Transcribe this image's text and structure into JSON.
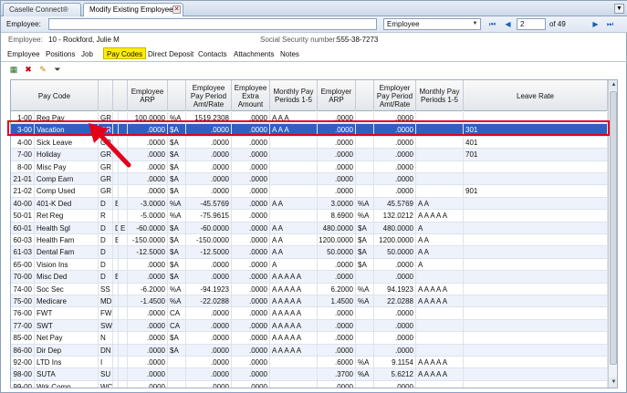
{
  "tabs": [
    {
      "label": "Caselle Connect®"
    },
    {
      "label": "Modify Existing Employees"
    }
  ],
  "employee_bar": {
    "label": "Employee:",
    "input_value": "",
    "select_value": "Employee",
    "page_value": "2",
    "page_total": "of 49"
  },
  "info": {
    "employee_label": "Employee:",
    "employee_value": "10 - Rockford, Julie M",
    "ssn_label": "Social Security number:",
    "ssn_value": "555-38-7273"
  },
  "subtabs": [
    "Employee",
    "Positions",
    "Job",
    "Pay Codes",
    "Direct Deposit",
    "Contacts",
    "Attachments",
    "Notes"
  ],
  "active_subtab": "Pay Codes",
  "toolbar_icons": [
    "grid-icon",
    "delete-icon",
    "pencil-icon",
    "filter-icon"
  ],
  "headers": {
    "pay_code": "Pay Code",
    "emp_arp": "Employee ARP",
    "emp_ppar": "Employee Pay Period Amt/Rate",
    "emp_extra": "Employee Extra Amount",
    "monthly1": "Monthly Pay Periods 1-5",
    "er_arp": "Employer ARP",
    "er_ppar": "Employer Pay Period Amt/Rate",
    "monthly2": "Monthly Pay Periods 1-5",
    "leave_rate": "Leave Rate"
  },
  "rows": [
    {
      "code": "1-00",
      "name": "Reg Pay",
      "type": "GR",
      "f1": "",
      "f2": "",
      "earp": "100.0000",
      "eu": "%A",
      "eppar": "1519.2308",
      "extra": ".0000",
      "m1": "A A A",
      "erarp": ".0000",
      "eru": "",
      "erppar": ".0000",
      "m2": "",
      "leave": ""
    },
    {
      "code": "3-00",
      "name": "Vacation",
      "type": "GR",
      "f1": "",
      "f2": "",
      "earp": ".0000",
      "eu": "$A",
      "eppar": ".0000",
      "extra": ".0000",
      "m1": "A A A",
      "erarp": ".0000",
      "eru": "",
      "erppar": ".0000",
      "m2": "",
      "leave": "301"
    },
    {
      "code": "4-00",
      "name": "Sick Leave",
      "type": "GR",
      "f1": "",
      "f2": "",
      "earp": ".0000",
      "eu": "$A",
      "eppar": ".0000",
      "extra": ".0000",
      "m1": "",
      "erarp": ".0000",
      "eru": "",
      "erppar": ".0000",
      "m2": "",
      "leave": "401"
    },
    {
      "code": "7-00",
      "name": "Holiday",
      "type": "GR",
      "f1": "",
      "f2": "",
      "earp": ".0000",
      "eu": "$A",
      "eppar": ".0000",
      "extra": ".0000",
      "m1": "",
      "erarp": ".0000",
      "eru": "",
      "erppar": ".0000",
      "m2": "",
      "leave": "701"
    },
    {
      "code": "8-00",
      "name": "Misc Pay",
      "type": "GR",
      "f1": "",
      "f2": "",
      "earp": ".0000",
      "eu": "$A",
      "eppar": ".0000",
      "extra": ".0000",
      "m1": "",
      "erarp": ".0000",
      "eru": "",
      "erppar": ".0000",
      "m2": "",
      "leave": ""
    },
    {
      "code": "21-01",
      "name": "Comp Earn",
      "type": "GR",
      "f1": "",
      "f2": "",
      "earp": ".0000",
      "eu": "$A",
      "eppar": ".0000",
      "extra": ".0000",
      "m1": "",
      "erarp": ".0000",
      "eru": "",
      "erppar": ".0000",
      "m2": "",
      "leave": ""
    },
    {
      "code": "21-02",
      "name": "Comp Used",
      "type": "GR",
      "f1": "",
      "f2": "",
      "earp": ".0000",
      "eu": "$A",
      "eppar": ".0000",
      "extra": ".0000",
      "m1": "",
      "erarp": ".0000",
      "eru": "",
      "erppar": ".0000",
      "m2": "",
      "leave": "901"
    },
    {
      "code": "40-00",
      "name": "401-K Ded",
      "type": "D",
      "f1": "B",
      "f2": "",
      "earp": "-3.0000",
      "eu": "%A",
      "eppar": "-45.5769",
      "extra": ".0000",
      "m1": "A A",
      "erarp": "3.0000",
      "eru": "%A",
      "erppar": "45.5769",
      "m2": "A A",
      "leave": ""
    },
    {
      "code": "50-01",
      "name": "Ret Reg",
      "type": "R",
      "f1": "",
      "f2": "",
      "earp": "-5.0000",
      "eu": "%A",
      "eppar": "-75.9615",
      "extra": ".0000",
      "m1": "",
      "erarp": "8.6900",
      "eru": "%A",
      "erppar": "132.0212",
      "m2": "A A A A A",
      "leave": ""
    },
    {
      "code": "60-01",
      "name": "Health Sgl",
      "type": "D",
      "f1": "D",
      "f2": "E",
      "earp": "-60.0000",
      "eu": "$A",
      "eppar": "-60.0000",
      "extra": ".0000",
      "m1": "A A",
      "erarp": "480.0000",
      "eru": "$A",
      "erppar": "480.0000",
      "m2": "A",
      "leave": ""
    },
    {
      "code": "60-03",
      "name": "Health Fam",
      "type": "D",
      "f1": "B",
      "f2": "",
      "earp": "-150.0000",
      "eu": "$A",
      "eppar": "-150.0000",
      "extra": ".0000",
      "m1": "A A",
      "erarp": "1200.0000",
      "eru": "$A",
      "erppar": "1200.0000",
      "m2": "A A",
      "leave": ""
    },
    {
      "code": "61-03",
      "name": "Dental Fam",
      "type": "D",
      "f1": "",
      "f2": "",
      "earp": "-12.5000",
      "eu": "$A",
      "eppar": "-12.5000",
      "extra": ".0000",
      "m1": "A A",
      "erarp": "50.0000",
      "eru": "$A",
      "erppar": "50.0000",
      "m2": "A A",
      "leave": ""
    },
    {
      "code": "65-00",
      "name": "Vision Ins",
      "type": "D",
      "f1": "",
      "f2": "",
      "earp": ".0000",
      "eu": "$A",
      "eppar": ".0000",
      "extra": ".0000",
      "m1": "A",
      "erarp": ".0000",
      "eru": "$A",
      "erppar": ".0000",
      "m2": "A",
      "leave": ""
    },
    {
      "code": "70-00",
      "name": "Misc Ded",
      "type": "D",
      "f1": "B",
      "f2": "",
      "earp": ".0000",
      "eu": "$A",
      "eppar": ".0000",
      "extra": ".0000",
      "m1": "A A A A A",
      "erarp": ".0000",
      "eru": "",
      "erppar": ".0000",
      "m2": "",
      "leave": ""
    },
    {
      "code": "74-00",
      "name": "Soc Sec",
      "type": "SS",
      "f1": "",
      "f2": "",
      "earp": "-6.2000",
      "eu": "%A",
      "eppar": "-94.1923",
      "extra": ".0000",
      "m1": "A A A A A",
      "erarp": "6.2000",
      "eru": "%A",
      "erppar": "94.1923",
      "m2": "A A A A A",
      "leave": ""
    },
    {
      "code": "75-00",
      "name": "Medicare",
      "type": "MD",
      "f1": "",
      "f2": "",
      "earp": "-1.4500",
      "eu": "%A",
      "eppar": "-22.0288",
      "extra": ".0000",
      "m1": "A A A A A",
      "erarp": "1.4500",
      "eru": "%A",
      "erppar": "22.0288",
      "m2": "A A A A A",
      "leave": ""
    },
    {
      "code": "76-00",
      "name": "FWT",
      "type": "FW",
      "f1": "",
      "f2": "",
      "earp": ".0000",
      "eu": "CA",
      "eppar": ".0000",
      "extra": ".0000",
      "m1": "A A A A A",
      "erarp": ".0000",
      "eru": "",
      "erppar": ".0000",
      "m2": "",
      "leave": ""
    },
    {
      "code": "77-00",
      "name": "SWT",
      "type": "SW",
      "f1": "",
      "f2": "",
      "earp": ".0000",
      "eu": "CA",
      "eppar": ".0000",
      "extra": ".0000",
      "m1": "A A A A A",
      "erarp": ".0000",
      "eru": "",
      "erppar": ".0000",
      "m2": "",
      "leave": ""
    },
    {
      "code": "85-00",
      "name": "Net Pay",
      "type": "N",
      "f1": "",
      "f2": "",
      "earp": ".0000",
      "eu": "$A",
      "eppar": ".0000",
      "extra": ".0000",
      "m1": "A A A A A",
      "erarp": ".0000",
      "eru": "",
      "erppar": ".0000",
      "m2": "",
      "leave": ""
    },
    {
      "code": "86-00",
      "name": "Dir Dep",
      "type": "DN",
      "f1": "",
      "f2": "",
      "earp": ".0000",
      "eu": "$A",
      "eppar": ".0000",
      "extra": ".0000",
      "m1": "A A A A A",
      "erarp": ".0000",
      "eru": "",
      "erppar": ".0000",
      "m2": "",
      "leave": ""
    },
    {
      "code": "92-00",
      "name": "LTD Ins",
      "type": "I",
      "f1": "",
      "f2": "",
      "earp": ".0000",
      "eu": "",
      "eppar": ".0000",
      "extra": ".0000",
      "m1": "",
      "erarp": ".6000",
      "eru": "%A",
      "erppar": "9.1154",
      "m2": "A A A A A",
      "leave": ""
    },
    {
      "code": "98-00",
      "name": "SUTA",
      "type": "SU",
      "f1": "",
      "f2": "",
      "earp": ".0000",
      "eu": "",
      "eppar": ".0000",
      "extra": ".0000",
      "m1": "",
      "erarp": ".3700",
      "eru": "%A",
      "erppar": "5.6212",
      "m2": "A A A A A",
      "leave": ""
    },
    {
      "code": "99-00",
      "name": "Wrk Comp",
      "type": "WC",
      "f1": "",
      "f2": "",
      "earp": ".0000",
      "eu": "",
      "eppar": ".0000",
      "extra": ".0000",
      "m1": "",
      "erarp": ".0000",
      "eru": "",
      "erppar": ".0000",
      "m2": "",
      "leave": ""
    }
  ],
  "selected_row": 1,
  "colors": {
    "selection": "#2f5fc4",
    "highlight": "#e3001b",
    "active_tab": "#ffee00"
  }
}
